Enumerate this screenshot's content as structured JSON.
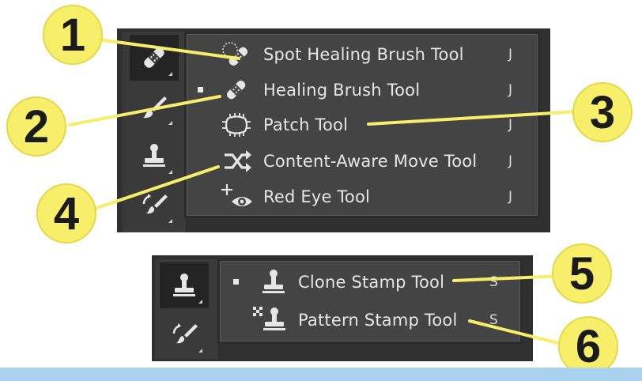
{
  "healing_flyout": {
    "items": [
      {
        "label": "Spot Healing Brush Tool",
        "shortcut": "J",
        "icon": "spot-healing-brush-icon",
        "selected": false
      },
      {
        "label": "Healing Brush Tool",
        "shortcut": "J",
        "icon": "healing-brush-icon",
        "selected": true
      },
      {
        "label": "Patch Tool",
        "shortcut": "J",
        "icon": "patch-icon",
        "selected": false
      },
      {
        "label": "Content-Aware Move Tool",
        "shortcut": "J",
        "icon": "content-aware-move-icon",
        "selected": false
      },
      {
        "label": "Red Eye Tool",
        "shortcut": "J",
        "icon": "red-eye-icon",
        "selected": false
      }
    ]
  },
  "stamp_flyout": {
    "items": [
      {
        "label": "Clone Stamp Tool",
        "shortcut": "S",
        "icon": "clone-stamp-icon",
        "selected": true
      },
      {
        "label": "Pattern Stamp Tool",
        "shortcut": "S",
        "icon": "pattern-stamp-icon",
        "selected": false
      }
    ]
  },
  "toolbar_top": [
    "healing-brush-icon",
    "brush-icon",
    "stamp-icon",
    "history-brush-icon"
  ],
  "toolbar_bottom": [
    "stamp-icon",
    "history-brush-icon"
  ],
  "callouts": [
    "1",
    "2",
    "3",
    "4",
    "5",
    "6"
  ],
  "colors": {
    "callout_fill": "#f7ef6a",
    "menu_bg": "#444444",
    "toolbar_bg": "#3a3a3a",
    "text": "#e6e6e6",
    "bottom_bar": "#a9d2ee"
  }
}
